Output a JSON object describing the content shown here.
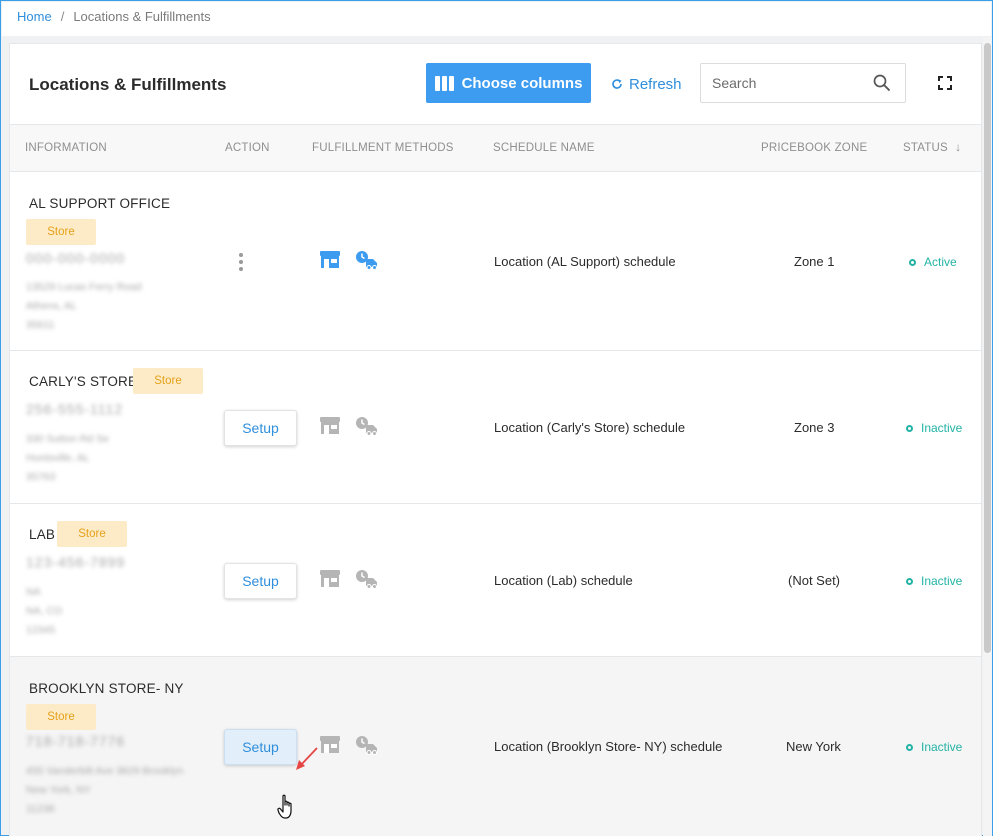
{
  "breadcrumb": {
    "home": "Home",
    "separator": "/",
    "current": "Locations & Fulfillments"
  },
  "page": {
    "title": "Locations & Fulfillments"
  },
  "toolbar": {
    "choose_columns_label": "Choose columns",
    "refresh_label": "Refresh",
    "search_placeholder": "Search",
    "icons": [
      "columns-icon",
      "refresh-icon",
      "search-icon",
      "fullscreen-icon"
    ]
  },
  "columns": {
    "information": "INFORMATION",
    "action": "ACTION",
    "fulfillment": "FULFILLMENT METHODS",
    "schedule": "SCHEDULE NAME",
    "pricebook": "PRICEBOOK ZONE",
    "status": "STATUS",
    "status_sort": "↓"
  },
  "rows": [
    {
      "name": "AL SUPPORT OFFICE",
      "tag": "Store",
      "phone": "000-000-0000",
      "address": [
        "13529 Lucas Ferry Road",
        "Athens, AL",
        "35611"
      ],
      "action": "menu",
      "setup_label": "",
      "fulfillment_active": true,
      "schedule": "Location (AL Support) schedule",
      "zone": "Zone 1",
      "status": "Active"
    },
    {
      "name": "CARLY'S STORE",
      "tag": "Store",
      "phone": "256-555-1112",
      "address": [
        "330 Sutton Rd Se",
        "Huntsville, AL",
        "35763"
      ],
      "action": "setup",
      "setup_label": "Setup",
      "fulfillment_active": false,
      "schedule": "Location (Carly's Store) schedule",
      "zone": "Zone 3",
      "status": "Inactive"
    },
    {
      "name": "LAB",
      "tag": "Store",
      "phone": "123-456-7899",
      "address": [
        "NA",
        "NA, CO",
        "12345"
      ],
      "action": "setup",
      "setup_label": "Setup",
      "fulfillment_active": false,
      "schedule": "Location (Lab) schedule",
      "zone": "(Not Set)",
      "status": "Inactive"
    },
    {
      "name": "BROOKLYN STORE- NY",
      "tag": "Store",
      "phone": "718-718-7776",
      "address": [
        "455 Vanderbilt Ave 3829 Brooklyn",
        "New York, NY",
        "11238"
      ],
      "action": "setup",
      "setup_label": "Setup",
      "fulfillment_active": false,
      "schedule": "Location (Brooklyn Store- NY) schedule",
      "zone": "New York",
      "status": "Inactive"
    }
  ],
  "colors": {
    "accent": "#3d9cf0",
    "link": "#2f8fdc",
    "tag_bg": "#fdebc8",
    "tag_text": "#e5a11a",
    "status": "#23b3a4",
    "icon_active": "#3d9cf0",
    "icon_inactive": "#b5b5b5",
    "annotation_arrow": "#e64545"
  }
}
